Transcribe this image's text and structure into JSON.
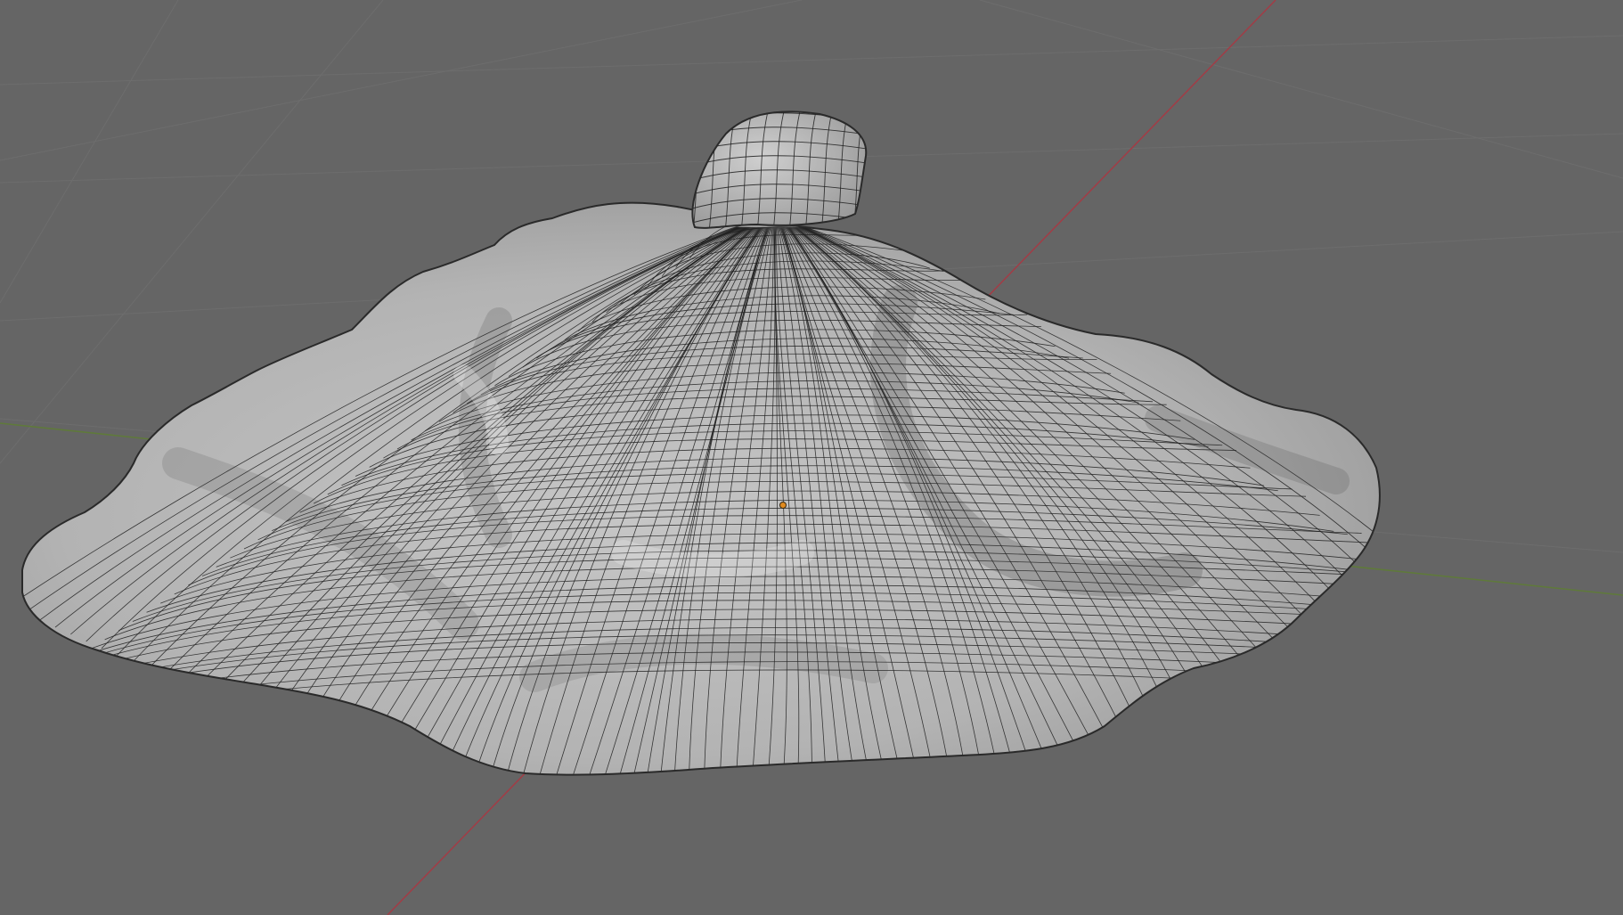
{
  "app": "Blender",
  "viewport": {
    "mode": "solid-wireframe",
    "background_color": "#656565",
    "grid_line_color": "#6d6d6d",
    "x_axis_color": "#a23c46",
    "y_axis_color": "#5f7a3a",
    "object_name": "",
    "object_color": "#b8b8b8",
    "wire_color": "#1f1f1f",
    "origin_color": "#e08a1e"
  }
}
